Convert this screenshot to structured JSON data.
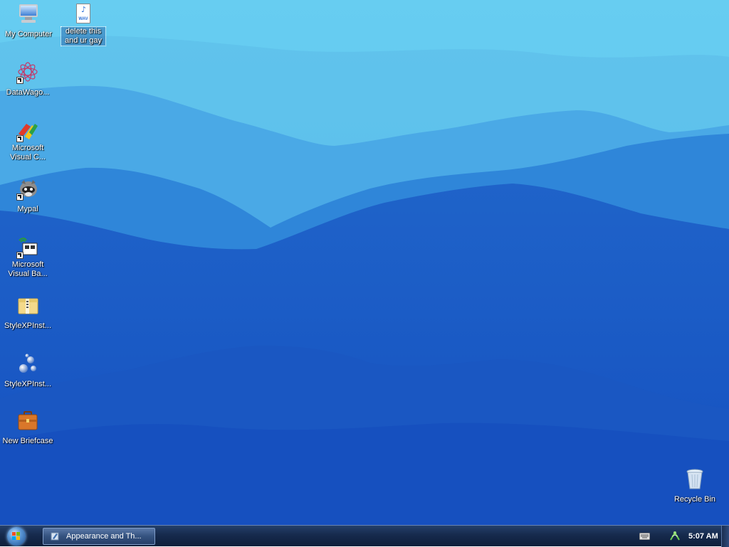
{
  "desktop": {
    "icons": [
      {
        "label": "My Computer"
      },
      {
        "label": "delete this and ur gay",
        "badge": "WAV"
      },
      {
        "label": "DataWago..."
      },
      {
        "label": "Microsoft Visual C..."
      },
      {
        "label": "Mypal"
      },
      {
        "label": "Microsoft Visual Ba..."
      },
      {
        "label": "StyleXPInst..."
      },
      {
        "label": "StyleXPInst..."
      },
      {
        "label": "New Briefcase"
      },
      {
        "label": "Recycle Bin"
      }
    ]
  },
  "taskbar": {
    "task_label": "Appearance and Th...",
    "clock": "5:07 AM"
  },
  "colors": {
    "sky": "#5fc6ee",
    "mountain_far": "#4aa9e6",
    "mountain_mid": "#2f86d9",
    "mountain_near": "#1f63c9",
    "forest": "#154dbb",
    "taskbar": "#162a4d"
  },
  "icons": {
    "start": "windows-start-orb",
    "task": "appearance-control-panel-icon",
    "tray_keyboard": "keyboard-icon",
    "tray_network": "network-icon"
  }
}
